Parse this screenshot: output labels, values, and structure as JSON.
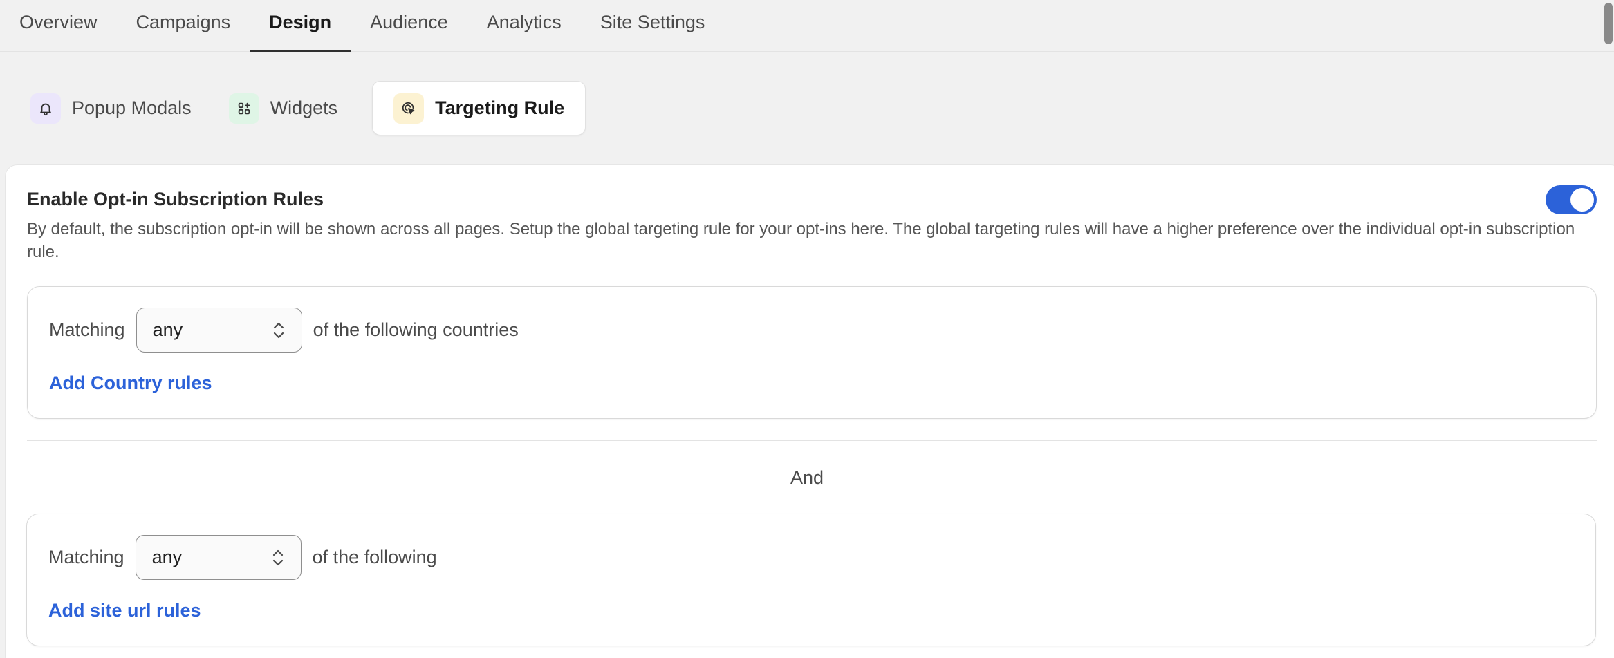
{
  "colors": {
    "accent": "#2c62d9",
    "link": "#2c62d9",
    "popup_icon_bg": "#ebe6fb",
    "widgets_icon_bg": "#dff5e6",
    "targeting_icon_bg": "#fcf2d2"
  },
  "topnav": {
    "tabs": [
      {
        "label": "Overview"
      },
      {
        "label": "Campaigns"
      },
      {
        "label": "Design"
      },
      {
        "label": "Audience"
      },
      {
        "label": "Analytics"
      },
      {
        "label": "Site Settings"
      }
    ],
    "active": "Design"
  },
  "subtabs": [
    {
      "label": "Popup Modals",
      "icon": "bell-icon"
    },
    {
      "label": "Widgets",
      "icon": "grid-icon"
    },
    {
      "label": "Targeting Rule",
      "icon": "target-cursor-icon"
    }
  ],
  "card": {
    "title": "Enable Opt-in Subscription Rules",
    "description": "By default, the subscription opt-in will be shown across all pages. Setup the global targeting rule for your opt-ins here. The global targeting rules will have a higher preference over the individual opt-in subscription rule.",
    "toggle_on": true
  },
  "country_rule": {
    "prefix": "Matching",
    "select_value": "any",
    "suffix": "of the following countries",
    "add_link": "Add Country rules"
  },
  "joiner": "And",
  "url_rule": {
    "prefix": "Matching",
    "select_value": "any",
    "suffix": "of the following",
    "add_link": "Add site url rules"
  }
}
